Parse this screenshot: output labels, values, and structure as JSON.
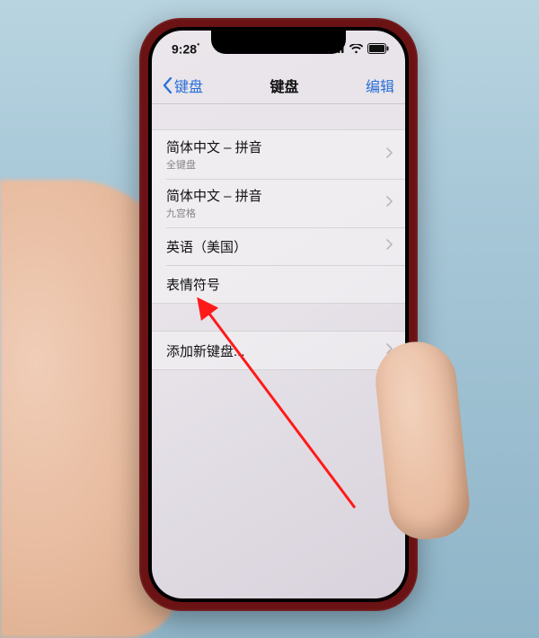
{
  "status_bar": {
    "time": "9:28",
    "time_badge": "ᐩ"
  },
  "nav": {
    "back_label": "键盘",
    "title": "键盘",
    "edit_label": "编辑"
  },
  "keyboards": [
    {
      "title": "简体中文 – 拼音",
      "subtitle": "全键盘",
      "has_chevron": true
    },
    {
      "title": "简体中文 – 拼音",
      "subtitle": "九宫格",
      "has_chevron": true
    },
    {
      "title": "英语（美国）",
      "subtitle": "",
      "has_chevron": true
    },
    {
      "title": "表情符号",
      "subtitle": "",
      "has_chevron": false
    }
  ],
  "add_new": {
    "label": "添加新键盘..."
  }
}
